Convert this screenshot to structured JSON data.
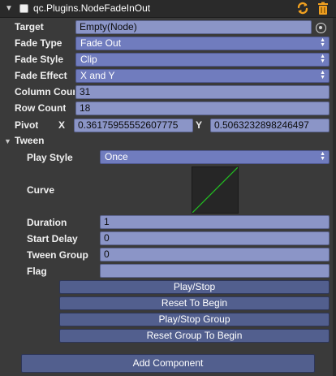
{
  "header": {
    "title": "qc.Plugins.NodeFadeInOut",
    "enabled": true,
    "icons": {
      "collapse": "triangle-down-icon",
      "refresh": "refresh-icon",
      "delete": "trash-icon"
    }
  },
  "fields": {
    "target": {
      "label": "Target",
      "value": "Empty(Node)"
    },
    "fade_type": {
      "label": "Fade Type",
      "value": "Fade Out"
    },
    "fade_style": {
      "label": "Fade Style",
      "value": "Clip"
    },
    "fade_effect": {
      "label": "Fade Effect",
      "value": "X and Y"
    },
    "column_count": {
      "label": "Column Coun",
      "value": "31"
    },
    "row_count": {
      "label": "Row Count",
      "value": "18"
    },
    "pivot": {
      "label": "Pivot",
      "x_label": "X",
      "x_value": "0.36175955552607775",
      "y_label": "Y",
      "y_value": "0.5063232898246497"
    }
  },
  "tween": {
    "label": "Tween",
    "play_style": {
      "label": "Play Style",
      "value": "Once"
    },
    "curve": {
      "label": "Curve"
    },
    "duration": {
      "label": "Duration",
      "value": "1"
    },
    "start_delay": {
      "label": "Start Delay",
      "value": "0"
    },
    "tween_group": {
      "label": "Tween Group",
      "value": "0"
    },
    "flag": {
      "label": "Flag",
      "value": ""
    }
  },
  "buttons": {
    "play_stop": "Play/Stop",
    "reset_to_begin": "Reset To Begin",
    "play_stop_group": "Play/Stop Group",
    "reset_group_to_begin": "Reset Group To Begin",
    "add_component": "Add Component"
  },
  "colors": {
    "panel_bg": "#3a3a3a",
    "field_bg": "#8b95c7",
    "select_bg": "#707cbe",
    "button_bg": "#525f8e",
    "accent_orange": "#f0a020",
    "curve_line": "#22c022"
  }
}
